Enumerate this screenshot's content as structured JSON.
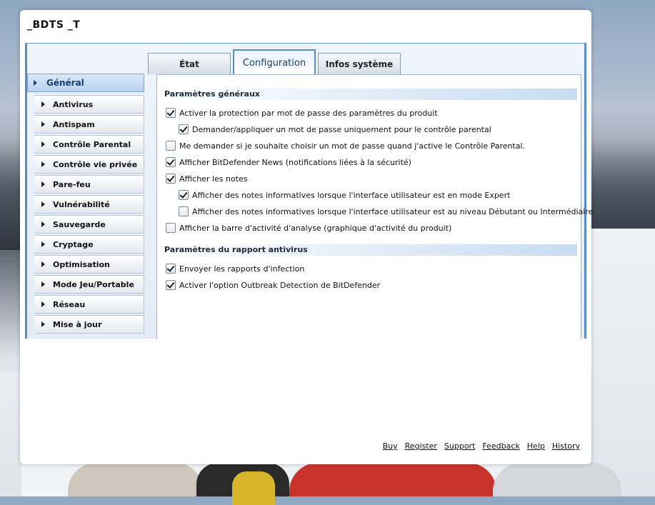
{
  "window": {
    "title": "_BDTS _T"
  },
  "tabs": [
    {
      "label": "État",
      "active": false
    },
    {
      "label": "Configuration",
      "active": true
    },
    {
      "label": "Infos système",
      "active": false
    }
  ],
  "sidebar": {
    "items": [
      {
        "label": "Général",
        "active": true
      },
      {
        "label": "Antivirus"
      },
      {
        "label": "Antispam"
      },
      {
        "label": "Contrôle Parental"
      },
      {
        "label": "Contrôle vie privée"
      },
      {
        "label": "Pare-feu"
      },
      {
        "label": "Vulnérabilité"
      },
      {
        "label": "Sauvegarde"
      },
      {
        "label": "Cryptage"
      },
      {
        "label": "Optimisation"
      },
      {
        "label": "Mode Jeu/Portable"
      },
      {
        "label": "Réseau"
      },
      {
        "label": "Mise à jour"
      }
    ]
  },
  "sections": {
    "general": {
      "title": "Paramètres généraux",
      "options": [
        {
          "label": "Activer la protection par mot de passe des paramètres du produit",
          "checked": true
        },
        {
          "label": "Demander/appliquer un mot de passe uniquement pour le contrôle parental",
          "checked": true
        },
        {
          "label": "Me demander si je souhaite choisir un mot de passe quand j'active le Contrôle Parental.",
          "checked": false
        },
        {
          "label": "Afficher BitDefender News (notifications liées à la sécurité)",
          "checked": true
        },
        {
          "label": "Afficher les notes",
          "checked": true
        },
        {
          "label": "Afficher des notes informatives lorsque l'interface utilisateur est en mode Expert",
          "checked": true
        },
        {
          "label": "Afficher des notes informatives lorsque l'interface utilisateur est au niveau Débutant ou Intermédiaire.",
          "checked": false
        },
        {
          "label": "Afficher la barre d'activité d'analyse (graphique d'activité du produit)",
          "checked": false
        }
      ]
    },
    "report": {
      "title": "Paramètres du rapport antivirus",
      "options": [
        {
          "label": "Envoyer les rapports d'infection",
          "checked": true
        },
        {
          "label": "Activer l'option Outbreak Detection de BitDefender",
          "checked": true
        }
      ]
    }
  },
  "footer": {
    "links": [
      "Buy",
      "Register",
      "Support",
      "Feedback",
      "Help",
      "History"
    ]
  },
  "colors": {
    "accent": "#5a8cc4",
    "active_text": "#1a3c70"
  }
}
